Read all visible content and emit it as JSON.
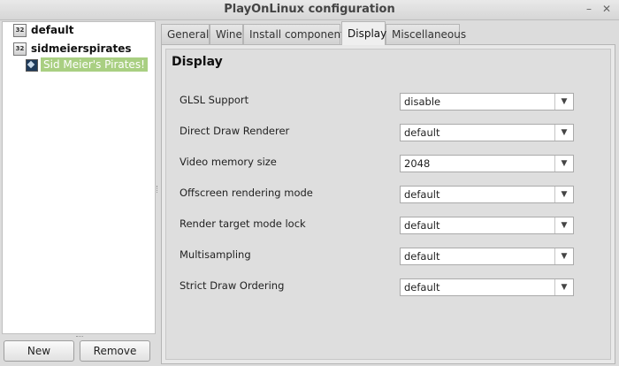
{
  "window": {
    "title": "PlayOnLinux configuration"
  },
  "tree": {
    "root1": {
      "label": "default",
      "icon": "32"
    },
    "root2": {
      "label": "sidmeierspirates",
      "icon": "32"
    },
    "child": {
      "label": "Sid Meier's Pirates!"
    }
  },
  "left_buttons": {
    "new": "New",
    "remove": "Remove"
  },
  "tabs": [
    {
      "label": "General"
    },
    {
      "label": "Wine"
    },
    {
      "label": "Install components"
    },
    {
      "label": "Display"
    },
    {
      "label": "Miscellaneous"
    }
  ],
  "display": {
    "title": "Display",
    "settings": [
      {
        "label": "GLSL Support",
        "value": "disable"
      },
      {
        "label": "Direct Draw Renderer",
        "value": "default"
      },
      {
        "label": "Video memory size",
        "value": "2048"
      },
      {
        "label": "Offscreen rendering mode",
        "value": "default"
      },
      {
        "label": "Render target mode lock",
        "value": "default"
      },
      {
        "label": "Multisampling",
        "value": "default"
      },
      {
        "label": "Strict Draw Ordering",
        "value": "default"
      }
    ]
  },
  "colors": {
    "selection": "#a9cf82",
    "window_bg": "#dcdcdc"
  }
}
